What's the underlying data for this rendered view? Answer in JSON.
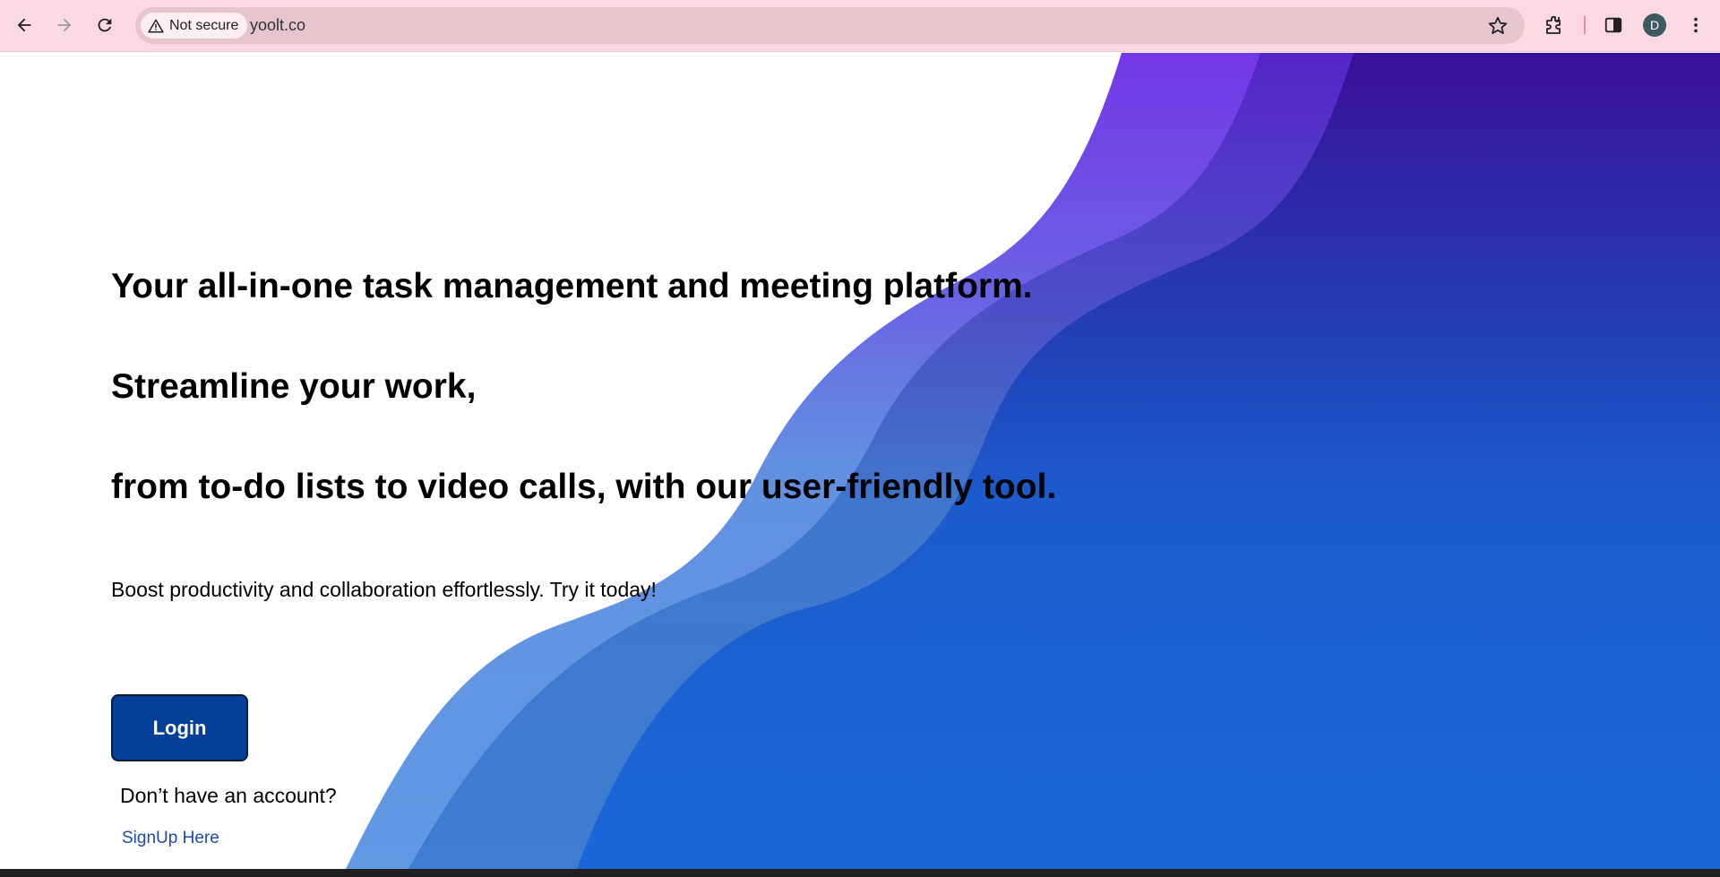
{
  "browser": {
    "security_label": "Not secure",
    "url": "yoolt.co",
    "profile_initial": "D",
    "icons": [
      "back-icon",
      "forward-icon",
      "reload-icon",
      "warning-icon",
      "star-icon",
      "extensions-icon",
      "side-panel-icon",
      "more-icon"
    ]
  },
  "hero": {
    "line1": "Your all-in-one task management and meeting platform.",
    "line2": "Streamline your work,",
    "line3": "from to-do lists to video calls, with our user-friendly tool.",
    "subtitle": "Boost productivity and collaboration effortlessly. Try it today!"
  },
  "auth": {
    "login_label": "Login",
    "no_account_text": "Don’t have an account?",
    "signup_label": "SignUp Here"
  },
  "colors": {
    "chrome_bg": "#fbd9e2",
    "login_button": "#04409a",
    "link": "#1b4aa8",
    "wave_light": "#6198e3",
    "wave_mid": "#3f7dd3",
    "wave_dark": "#1a66d6",
    "wave_top_purple": "#3a0f98"
  }
}
